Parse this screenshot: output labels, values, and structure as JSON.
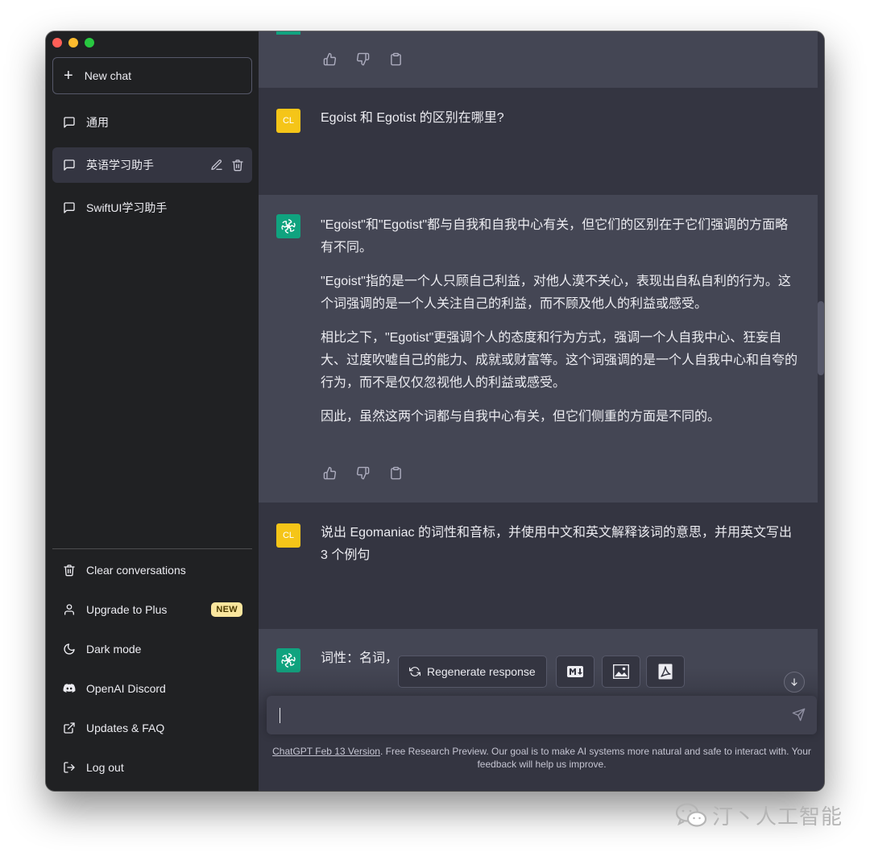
{
  "sidebar": {
    "new_chat": "New chat",
    "conversations": [
      "通用",
      "英语学习助手",
      "SwiftUI学习助手"
    ],
    "menu": {
      "clear": "Clear conversations",
      "upgrade": "Upgrade to Plus",
      "upgrade_badge": "NEW",
      "dark_mode": "Dark mode",
      "discord": "OpenAI Discord",
      "faq": "Updates & FAQ",
      "logout": "Log out"
    }
  },
  "chat": {
    "user_avatar": "CL",
    "question1": "Egoist 和 Egotist 的区别在哪里?",
    "answer1": [
      "\"Egoist\"和\"Egotist\"都与自我和自我中心有关，但它们的区别在于它们强调的方面略有不同。",
      "\"Egoist\"指的是一个人只顾自己利益，对他人漠不关心，表现出自私自利的行为。这个词强调的是一个人关注自己的利益，而不顾及他人的利益或感受。",
      "相比之下，\"Egotist\"更强调个人的态度和行为方式，强调一个人自我中心、狂妄自大、过度吹嘘自己的能力、成就或财富等。这个词强调的是一个人自我中心和自夸的行为，而不是仅仅忽视他人的利益或感受。",
      "因此，虽然这两个词都与自我中心有关，但它们侧重的方面是不同的。"
    ],
    "question2": "说出 Egomaniac 的词性和音标，并使用中文和英文解释该词的意思，并用英文写出 3 个例句",
    "answer2_partial": "词性：名词，"
  },
  "controls": {
    "regenerate": "Regenerate response",
    "input_placeholder": ""
  },
  "footer": {
    "version_link": "ChatGPT Feb 13 Version",
    "text": ". Free Research Preview. Our goal is to make AI systems more natural and safe to interact with. Your feedback will help us improve."
  },
  "watermark": "汀丶人工智能",
  "colors": {
    "sidebar_bg": "#202123",
    "main_bg": "#343541",
    "ai_bg": "#444654",
    "openai_green": "#10a37f",
    "user_avatar": "#f5c518",
    "badge": "#fae69e"
  }
}
